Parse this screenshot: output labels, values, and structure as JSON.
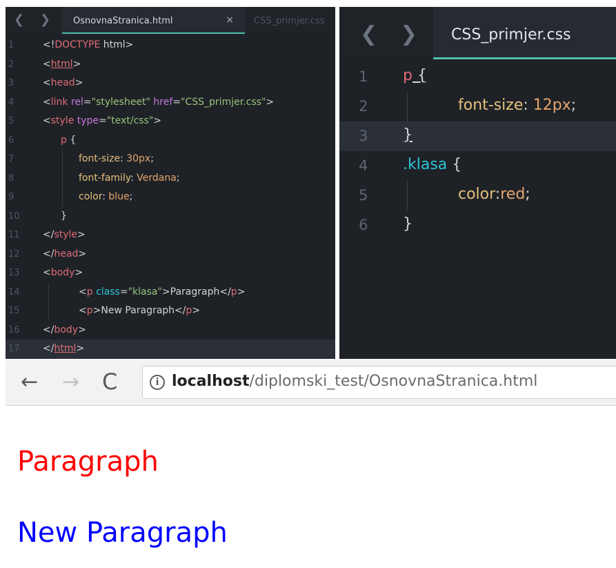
{
  "left_editor": {
    "nav": {
      "back": "❮",
      "forward": "❯"
    },
    "active_tab": {
      "label": "OsnovnaStranica.html",
      "close": "×"
    },
    "inactive_tab": {
      "label": "CSS_primjer.css"
    },
    "line_numbers": [
      "1",
      "2",
      "3",
      "4",
      "5",
      "6",
      "7",
      "8",
      "9",
      "10",
      "11",
      "12",
      "13",
      "14",
      "15",
      "16",
      "17"
    ],
    "current_line": 17
  },
  "right_editor": {
    "nav": {
      "back": "❮",
      "forward": "❯"
    },
    "active_tab": {
      "label": "CSS_primjer.css"
    },
    "line_numbers": [
      "1",
      "2",
      "3",
      "4",
      "5",
      "6"
    ],
    "current_line": 3
  },
  "browser": {
    "nav": {
      "back": "←",
      "forward": "→",
      "reload": "C"
    },
    "info_icon": "i",
    "url": {
      "host": "localhost",
      "path": "/diplomski_test/OsnovnaStranica.html"
    },
    "paragraphs": [
      {
        "text": "Paragraph",
        "color": "#ff0000"
      },
      {
        "text": "New Paragraph",
        "color": "#0000ff"
      }
    ]
  },
  "colors": {
    "editor_bg": "#1e2227",
    "tab_accent": "#4dbfb0",
    "tag": "#e06c75",
    "attribute": "#c678dd",
    "string": "#98c379",
    "property": "#e5c07b",
    "class_selector": "#2ec4d6"
  },
  "code_left": [
    {
      "t": "<!"
    },
    {
      "t": "DOCTYPE",
      "c": "tag"
    },
    {
      "t": " html>"
    }
  ],
  "html_code": {
    "l1_a": "<!",
    "l1_b": "DOCTYPE",
    "l1_c": " html>",
    "l2_a": "<",
    "l2_b": "html",
    "l2_c": ">",
    "l3_a": "<",
    "l3_b": "head",
    "l3_c": ">",
    "l4_a": "<",
    "l4_b": "link",
    "l4_c": " rel",
    "l4_d": "=",
    "l4_e": "\"stylesheet\"",
    "l4_f": " href",
    "l4_g": "=",
    "l4_h": "\"CSS_primjer.css\"",
    "l4_i": ">",
    "l5_a": "<",
    "l5_b": "style",
    "l5_c": " type",
    "l5_d": "=",
    "l5_e": "\"text/css\"",
    "l5_f": ">",
    "l6_a": "p",
    "l6_b": " {",
    "l7_a": "font-size",
    "l7_b": ": ",
    "l7_c": "30px",
    "l7_d": ";",
    "l8_a": "font-family",
    "l8_b": ": ",
    "l8_c": "Verdana",
    "l8_d": ";",
    "l9_a": "color",
    "l9_b": ": ",
    "l9_c": "blue",
    "l9_d": ";",
    "l10_a": "}",
    "l11_a": "</",
    "l11_b": "style",
    "l11_c": ">",
    "l12_a": "</",
    "l12_b": "head",
    "l12_c": ">",
    "l13_a": "<",
    "l13_b": "body",
    "l13_c": ">",
    "l14_a": "<",
    "l14_b": "p",
    "l14_c": " class",
    "l14_d": "=",
    "l14_e": "\"klasa\"",
    "l14_f": ">Paragraph</",
    "l14_g": "p",
    "l14_h": ">",
    "l15_a": "<",
    "l15_b": "p",
    "l15_c": ">New Paragraph</",
    "l15_d": "p",
    "l15_e": ">",
    "l16_a": "</",
    "l16_b": "body",
    "l16_c": ">",
    "l17_a": "</",
    "l17_b": "html",
    "l17_c": ">"
  },
  "css_code": {
    "l1_a": "p",
    "l1_b": " {",
    "l2_a": "font-size",
    "l2_b": ": ",
    "l2_c": "12px",
    "l2_d": ";",
    "l3_a": "}",
    "l4_a": ".klasa",
    "l4_b": " {",
    "l5_a": "color",
    "l5_b": ":",
    "l5_c": "red",
    "l5_d": ";",
    "l6_a": "}"
  }
}
